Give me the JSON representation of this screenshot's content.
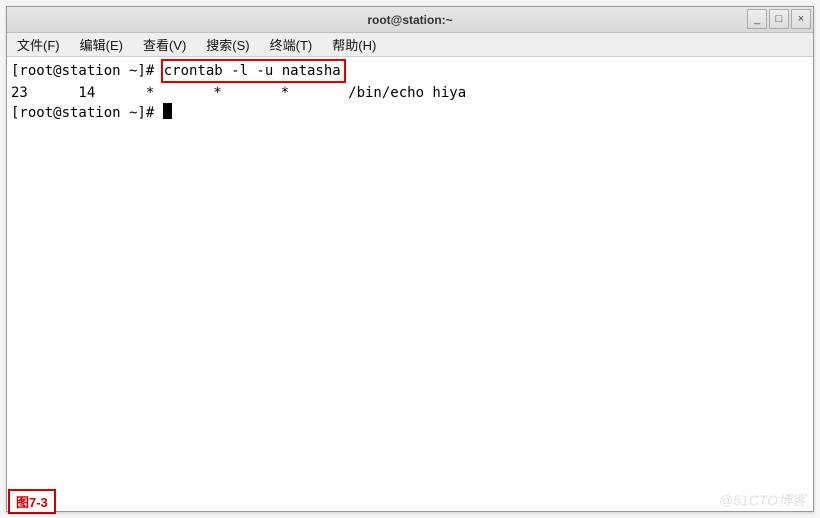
{
  "window": {
    "title": "root@station:~"
  },
  "controls": {
    "min": "_",
    "max": "□",
    "close": "×"
  },
  "menu": {
    "file": "文件(F)",
    "edit": "编辑(E)",
    "view": "查看(V)",
    "search": "搜索(S)",
    "terminal": "终端(T)",
    "help": "帮助(H)"
  },
  "term": {
    "prompt1a": "[root@station ~]# ",
    "cmd1": "crontab -l -u natasha",
    "cronline": "23      14      *       *       *       /bin/echo hiya",
    "prompt2": "[root@station ~]# "
  },
  "caption": "图7-3",
  "watermark": "@51CTO博客"
}
